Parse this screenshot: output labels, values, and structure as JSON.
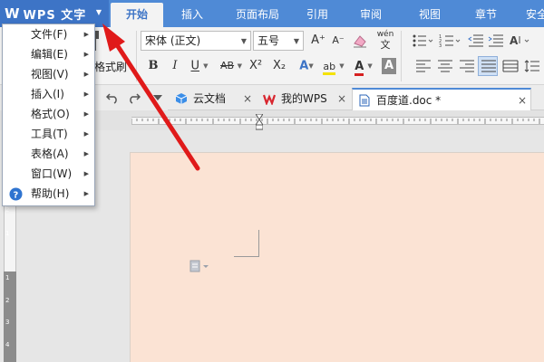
{
  "app": {
    "title": "WPS 文字",
    "logo_glyph": "W",
    "dropdown_glyph": "▼"
  },
  "ribbon_tabs": [
    "开始",
    "插入",
    "页面布局",
    "引用",
    "审阅",
    "视图",
    "章节",
    "安全"
  ],
  "ribbon": {
    "format_painter_label": "格式刷",
    "font_name": "宋体 (正文)",
    "font_size": "五号",
    "bold": "B",
    "italic": "I",
    "underline": "U",
    "strike": "AB",
    "superscript": "X²",
    "subscript": "X₂",
    "font_color_letter": "A",
    "highlight_letter": "ab",
    "grow_font": "A⁺",
    "shrink_font": "A⁻",
    "phonetic": "wén",
    "accent_colors": {
      "highlight": "#f4e200",
      "font_color": "#d62020",
      "shade": "#7a7a7a"
    }
  },
  "document_tabs": [
    {
      "label": "云文档",
      "icon": "cloud-doc-icon",
      "close": "×"
    },
    {
      "label": "我的WPS",
      "icon": "wps-logo-icon",
      "close": "×"
    },
    {
      "label": "百度道.doc *",
      "icon": "doc-file-icon",
      "close": "×"
    }
  ],
  "menu": {
    "items": [
      {
        "label": "文件(F)",
        "arrow": "▶"
      },
      {
        "label": "编辑(E)",
        "arrow": "▶"
      },
      {
        "label": "视图(V)",
        "arrow": "▶"
      },
      {
        "label": "插入(I)",
        "arrow": "▶"
      },
      {
        "label": "格式(O)",
        "arrow": "▶"
      },
      {
        "label": "工具(T)",
        "arrow": "▶"
      },
      {
        "label": "表格(A)",
        "arrow": "▶"
      },
      {
        "label": "窗口(W)",
        "arrow": "▶"
      },
      {
        "label": "帮助(H)",
        "arrow": "▶",
        "icon": "help-icon"
      }
    ]
  },
  "vertical_ruler": [
    "2",
    "1",
    "1",
    "2",
    "3",
    "4"
  ],
  "colors": {
    "title_bar": "#4f8ad6",
    "app_button": "#3d74c6",
    "page_background": "#fbe3d4",
    "annotation_arrow": "#e01a1a"
  }
}
